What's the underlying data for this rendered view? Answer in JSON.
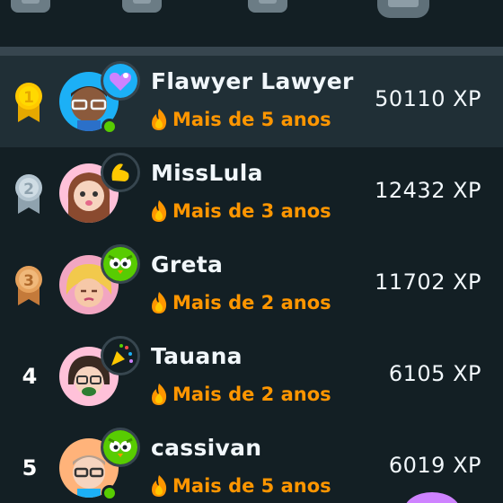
{
  "leaderboard": {
    "rows": [
      {
        "rank": "1",
        "name": "Flawyer Lawyer",
        "streak": "Mais de 5 anos",
        "xp": "50110 XP"
      },
      {
        "rank": "2",
        "name": "MissLula",
        "streak": "Mais de 3 anos",
        "xp": "12432 XP"
      },
      {
        "rank": "3",
        "name": "Greta",
        "streak": "Mais de 2 anos",
        "xp": "11702 XP"
      },
      {
        "rank": "4",
        "name": "Tauana",
        "streak": "Mais de 2 anos",
        "xp": "6105 XP"
      },
      {
        "rank": "5",
        "name": "cassivan",
        "streak": "Mais de 5 anos",
        "xp": "6019 XP"
      }
    ]
  },
  "colors": {
    "background": "#131f24",
    "highlight_row": "#202f36",
    "divider": "#37464f",
    "streak": "#ff9600",
    "gold": "#ffc800",
    "silver": "#b3c4cf",
    "bronze": "#e5a15c",
    "online": "#58cc02"
  }
}
